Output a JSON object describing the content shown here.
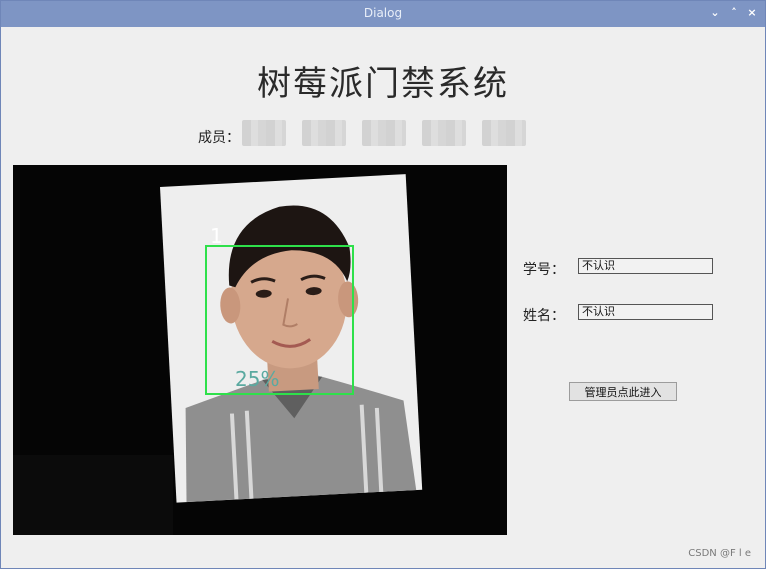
{
  "window": {
    "title": "Dialog",
    "controls": {
      "minimize": "⌄",
      "maximize": "˄",
      "close": "×"
    }
  },
  "app": {
    "title": "树莓派门禁系统",
    "members_label": "成员："
  },
  "camera": {
    "face_id": "1",
    "confidence": "25%",
    "box_color": "#2ee04a"
  },
  "form": {
    "student_id_label": "学号：",
    "student_id_value": "不认识",
    "name_label": "姓名：",
    "name_value": "不认识",
    "admin_button": "管理员点此进入"
  },
  "watermark": "CSDN @F l e",
  "colors": {
    "titlebar": "#7e95c4",
    "window_bg": "#efefef",
    "camera_bg": "#050505"
  }
}
